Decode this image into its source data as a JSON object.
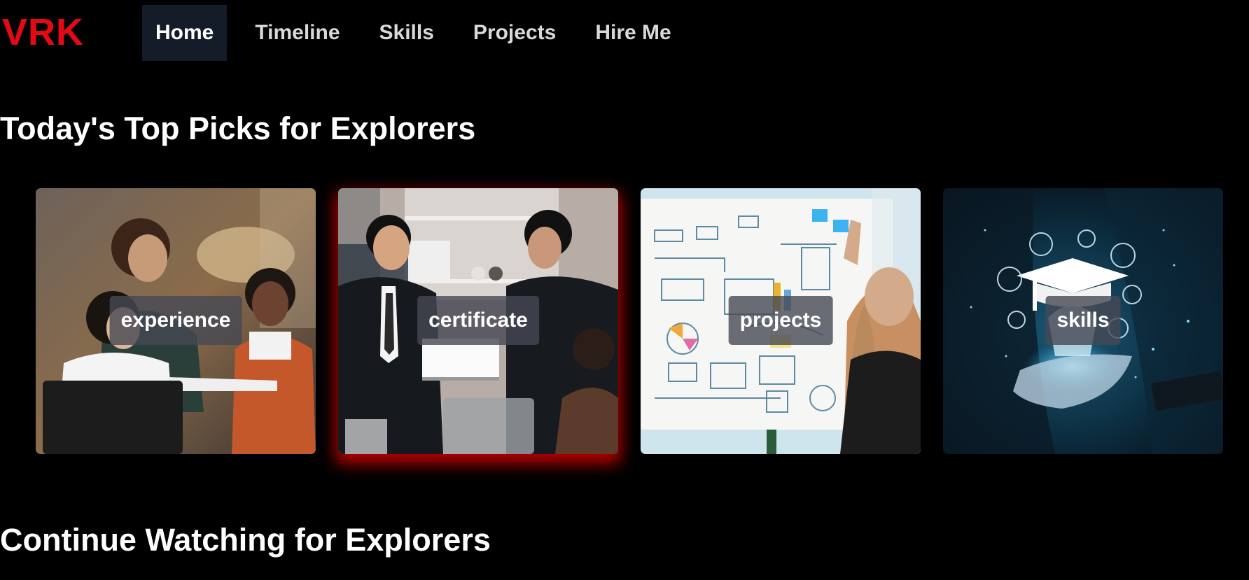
{
  "header": {
    "logo": "VRK",
    "nav": [
      "Home",
      "Timeline",
      "Skills",
      "Projects",
      "Hire Me"
    ],
    "active": "Home"
  },
  "sections": {
    "top_picks_title": "Today's Top Picks for Explorers",
    "continue_title": "Continue Watching for Explorers"
  },
  "cards": [
    {
      "label": "experience"
    },
    {
      "label": "certificate"
    },
    {
      "label": "projects"
    },
    {
      "label": "skills"
    }
  ],
  "colors": {
    "brand": "#e50914",
    "background": "#000000",
    "active_nav": "#141b29"
  }
}
